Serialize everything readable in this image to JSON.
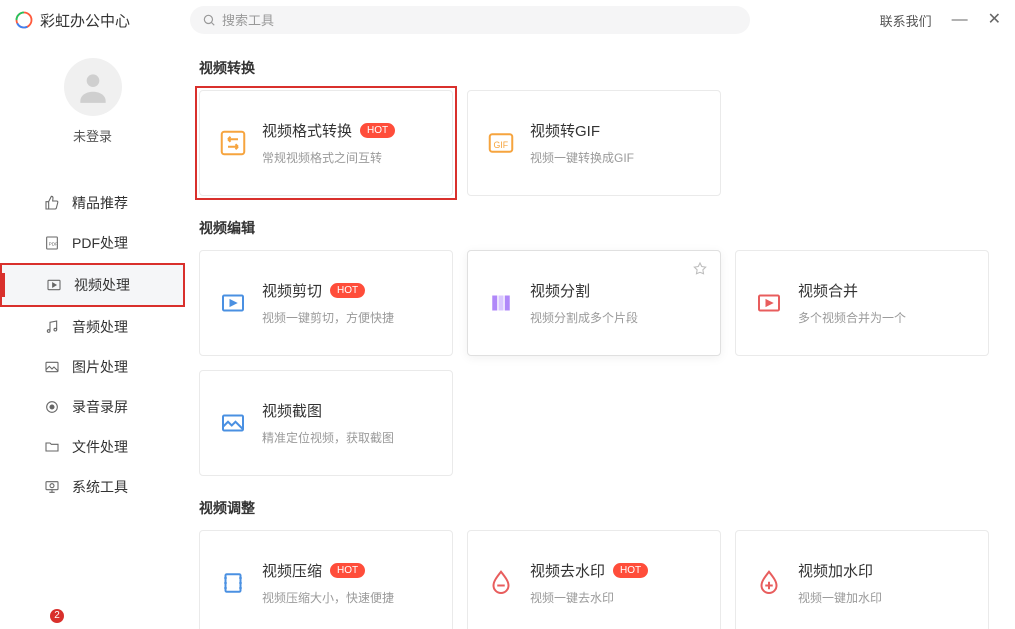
{
  "app": {
    "title": "彩虹办公中心"
  },
  "search": {
    "placeholder": "搜索工具"
  },
  "titlebar": {
    "contact": "联系我们"
  },
  "sidebar": {
    "login_label": "未登录",
    "items": [
      {
        "label": "精品推荐"
      },
      {
        "label": "PDF处理"
      },
      {
        "label": "视频处理"
      },
      {
        "label": "音频处理"
      },
      {
        "label": "图片处理"
      },
      {
        "label": "录音录屏"
      },
      {
        "label": "文件处理"
      },
      {
        "label": "系统工具"
      }
    ],
    "badge_count": "2"
  },
  "sections": {
    "convert": {
      "title": "视频转换",
      "cards": [
        {
          "title": "视频格式转换",
          "desc": "常规视频格式之间互转",
          "hot": "HOT"
        },
        {
          "title": "视频转GIF",
          "desc": "视频一键转换成GIF"
        }
      ]
    },
    "edit": {
      "title": "视频编辑",
      "cards": [
        {
          "title": "视频剪切",
          "desc": "视频一键剪切，方便快捷",
          "hot": "HOT"
        },
        {
          "title": "视频分割",
          "desc": "视频分割成多个片段"
        },
        {
          "title": "视频合并",
          "desc": "多个视频合并为一个"
        },
        {
          "title": "视频截图",
          "desc": "精准定位视频，获取截图"
        }
      ]
    },
    "adjust": {
      "title": "视频调整",
      "cards": [
        {
          "title": "视频压缩",
          "desc": "视频压缩大小，快速便捷",
          "hot": "HOT"
        },
        {
          "title": "视频去水印",
          "desc": "视频一键去水印",
          "hot": "HOT"
        },
        {
          "title": "视频加水印",
          "desc": "视频一键加水印"
        }
      ]
    }
  }
}
